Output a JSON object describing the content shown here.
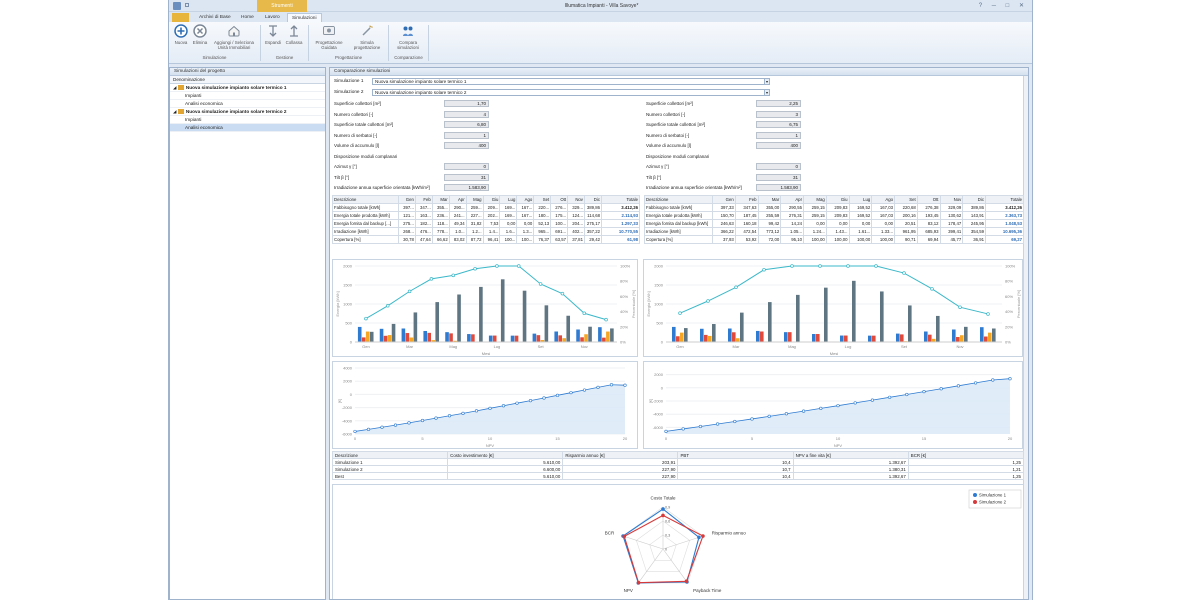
{
  "window": {
    "title": "Illumatica Impianti - Villa Savoye*",
    "context_tab": "Strumenti Simulazione",
    "controls": "? ─ □ ✕"
  },
  "tabs": [
    "",
    "Archivi di Base",
    "Home",
    "Lavoro",
    "Simulazioni"
  ],
  "ribbon": {
    "buttons": [
      {
        "label": "Nuova",
        "icon": "add-icon"
      },
      {
        "label": "Elimina",
        "icon": "delete-icon"
      },
      {
        "label": "Aggiungi / Seleziona Unità Immobiliari",
        "icon": "home-icon"
      },
      {
        "label": "Espandi",
        "icon": "expand-icon"
      },
      {
        "label": "Collassa",
        "icon": "collapse-icon"
      },
      {
        "label": "Progettazione Guidata",
        "icon": "wizard-icon"
      },
      {
        "label": "Simula progettazione",
        "icon": "magic-wand-icon"
      },
      {
        "label": "Compara simulazioni",
        "icon": "compare-icon"
      }
    ],
    "groups": [
      "Simulazione",
      "Gestione",
      "Progettazione",
      "Comparazione"
    ]
  },
  "left_panel": {
    "title": "Simulazioni del progetto",
    "column": "Denominazione",
    "tree": [
      {
        "label": "Nuova simulazione impianto solare termico 1",
        "level": 0,
        "bold": true
      },
      {
        "label": "Impianti",
        "level": 1
      },
      {
        "label": "Analisi economica",
        "level": 1
      },
      {
        "label": "Nuova simulazione impianto solare termico 2",
        "level": 0,
        "bold": true
      },
      {
        "label": "Impianti",
        "level": 1
      },
      {
        "label": "Analisi economica",
        "level": 1,
        "selected": true
      }
    ]
  },
  "main": {
    "title": "Comparazione simulazioni",
    "sim1_label": "Simulazione 1",
    "sim1_value": "Nuova simulazione impianto solare termico 1",
    "sim2_label": "Simulazione 2",
    "sim2_value": "Nuova simulazione impianto solare termico 2",
    "fields_labels": [
      "Superficie collettori [m²]",
      "Numero collettori [-]",
      "Superficie totale collettori [m²]",
      "Numero di serbatoi [-]",
      "Volume di accumulo [l]",
      "Disposizione moduli complanari",
      "Azimut γ [°]",
      "Tilt β [°]",
      "Irradiazione annua superficie orientata [kWh/m²]"
    ],
    "fields_left": [
      "1,70",
      "4",
      "6,80",
      "1",
      "400",
      "",
      "0",
      "31",
      "1.583,90"
    ],
    "fields_right": [
      "2,25",
      "3",
      "6,75",
      "1",
      "400",
      "",
      "0",
      "31",
      "1.583,90"
    ],
    "table_header": [
      "Descrizione",
      "Gen",
      "Feb",
      "Mar",
      "Apr",
      "Mag",
      "Giu",
      "Lug",
      "Ago",
      "Set",
      "Ott",
      "Nov",
      "Dic",
      "Totale"
    ],
    "table_left": [
      [
        "Fabbisogno totale [kWh]",
        "397...",
        "347...",
        "355...",
        "290...",
        "259...",
        "209...",
        "169...",
        "167...",
        "220...",
        "276...",
        "329...",
        "389,86",
        "3.412,26"
      ],
      [
        "Energia totale prodotta [kWh]",
        "121...",
        "163...",
        "236...",
        "241...",
        "227...",
        "202...",
        "169...",
        "167...",
        "180...",
        "175...",
        "124...",
        "114,68",
        "2.114,93"
      ],
      [
        "Energia fornita dal backup [...]",
        "275...",
        "182...",
        "118...",
        "49,34",
        "31,82",
        "7,53",
        "0,00",
        "0,00",
        "52,13",
        "100...",
        "204...",
        "275,17",
        "1.297,33"
      ],
      [
        "Irradiazione [kWh]",
        "268...",
        "476...",
        "778...",
        "1.0...",
        "1.2...",
        "1.4...",
        "1.6...",
        "1.3...",
        "965...",
        "691...",
        "402...",
        "357,22",
        "10.770,55"
      ],
      [
        "Copertura [%]",
        "30,78",
        "47,64",
        "66,62",
        "83,02",
        "87,72",
        "96,41",
        "100...",
        "100...",
        "76,37",
        "63,57",
        "37,81",
        "29,42",
        "61,98"
      ]
    ],
    "table_right": [
      [
        "Fabbisogno totale [kWh]",
        "397,33",
        "347,63",
        "355,00",
        "290,55",
        "259,15",
        "209,83",
        "169,52",
        "167,03",
        "220,68",
        "276,38",
        "329,09",
        "389,86",
        "3.412,26"
      ],
      [
        "Energia totale prodotta [kWh]",
        "150,70",
        "187,45",
        "255,59",
        "276,31",
        "259,15",
        "209,83",
        "169,52",
        "167,03",
        "200,16",
        "193,45",
        "130,62",
        "143,91",
        "2.363,73"
      ],
      [
        "Energia fornita dal backup [kWh]",
        "246,63",
        "160,18",
        "99,42",
        "14,24",
        "0,00",
        "0,00",
        "0,00",
        "0,00",
        "20,51",
        "83,12",
        "178,47",
        "245,95",
        "1.048,53"
      ],
      [
        "Irradiazione [kWh]",
        "366,22",
        "472,54",
        "773,12",
        "1.05...",
        "1.24...",
        "1.43...",
        "1.61...",
        "1.33...",
        "961,95",
        "685,93",
        "399,41",
        "354,59",
        "10.695,36"
      ],
      [
        "Copertura [%]",
        "37,93",
        "53,92",
        "72,00",
        "95,10",
        "100,00",
        "100,00",
        "100,00",
        "100,00",
        "90,71",
        "69,94",
        "45,77",
        "36,91",
        "69,27"
      ]
    ],
    "summary_header": [
      "Descrizione",
      "Costo investimento [€]",
      "Risparmio annuo [€]",
      "PBT",
      "NPV a fine vita [€]",
      "BCR [€]"
    ],
    "summary_rows": [
      [
        "Simulazione 1",
        "5.610,00",
        "203,91",
        "10,4",
        "1.392,67",
        "1,25"
      ],
      [
        "Simulazione 2",
        "6.600,00",
        "227,90",
        "10,7",
        "1.380,31",
        "1,21"
      ],
      [
        "Best",
        "5.610,00",
        "227,90",
        "10,4",
        "1.392,67",
        "1,25"
      ]
    ]
  },
  "chart_data": [
    {
      "type": "bar",
      "categories": [
        "Gen",
        "Feb",
        "Mar",
        "Apr",
        "Mag",
        "Giu",
        "Lug",
        "Ago",
        "Set",
        "Ott",
        "Nov",
        "Dic"
      ],
      "xlabel": "Mesi",
      "ylabel": "Energia [kWh]",
      "y2label": "Percentuale [%]",
      "tick_labels_x": [
        "Gen",
        "Mar",
        "Mag",
        "Lug",
        "Set",
        "Nov"
      ],
      "ylim": [
        0,
        2000
      ],
      "y2lim": [
        0,
        100
      ],
      "y_ticks": [
        "2000",
        "1500",
        "1000",
        "500",
        "0"
      ],
      "y2_ticks": [
        "100%",
        "80%",
        "60%",
        "40%",
        "20%",
        "0%"
      ],
      "series": [
        {
          "values": [
            397,
            347,
            355,
            290,
            259,
            209,
            169,
            167,
            220,
            276,
            329,
            390
          ],
          "color": "#2e7bd1"
        },
        {
          "values": [
            121,
            163,
            236,
            241,
            227,
            202,
            169,
            167,
            180,
            175,
            124,
            115
          ],
          "color": "#e04a3c"
        },
        {
          "values": [
            275,
            182,
            118,
            49,
            32,
            8,
            0,
            0,
            52,
            100,
            204,
            275
          ],
          "color": "#f5a623"
        },
        {
          "values": [
            268,
            476,
            778,
            1050,
            1250,
            1450,
            1650,
            1350,
            965,
            691,
            402,
            357
          ],
          "color": "#5f7582"
        },
        {
          "values": [
            30.78,
            47.64,
            66.62,
            83.02,
            87.72,
            96.41,
            100,
            100,
            76.37,
            63.57,
            37.81,
            29.42
          ],
          "color": "#3bb8c9",
          "axis": "y2",
          "kind": "line"
        }
      ]
    },
    {
      "type": "bar",
      "categories": [
        "Gen",
        "Feb",
        "Mar",
        "Apr",
        "Mag",
        "Giu",
        "Lug",
        "Ago",
        "Set",
        "Ott",
        "Nov",
        "Dic"
      ],
      "xlabel": "Mesi",
      "ylabel": "Energia [kWh]",
      "y2label": "Percentuale [%]",
      "tick_labels_x": [
        "Gen",
        "Mar",
        "Mag",
        "Lug",
        "Set",
        "Nov"
      ],
      "ylim": [
        0,
        2000
      ],
      "y2lim": [
        0,
        100
      ],
      "y_ticks": [
        "2000",
        "1500",
        "1000",
        "500",
        "0"
      ],
      "y2_ticks": [
        "100%",
        "80%",
        "60%",
        "40%",
        "20%",
        "0%"
      ],
      "series": [
        {
          "values": [
            397,
            348,
            355,
            291,
            259,
            210,
            170,
            167,
            221,
            276,
            329,
            390
          ],
          "color": "#2e7bd1"
        },
        {
          "values": [
            151,
            187,
            256,
            276,
            259,
            210,
            170,
            167,
            200,
            193,
            131,
            144
          ],
          "color": "#e04a3c"
        },
        {
          "values": [
            247,
            160,
            99,
            14,
            0,
            0,
            0,
            0,
            21,
            83,
            178,
            246
          ],
          "color": "#f5a623"
        },
        {
          "values": [
            366,
            473,
            773,
            1050,
            1240,
            1430,
            1610,
            1330,
            962,
            686,
            399,
            355
          ],
          "color": "#5f7582"
        },
        {
          "values": [
            37.93,
            53.92,
            72,
            95.1,
            100,
            100,
            100,
            100,
            90.71,
            69.94,
            45.77,
            36.91
          ],
          "color": "#3bb8c9",
          "axis": "y2",
          "kind": "line"
        }
      ]
    },
    {
      "type": "line",
      "xlabel": "NPV",
      "ylabel": "[€]",
      "x": [
        0,
        1,
        2,
        3,
        4,
        5,
        6,
        7,
        8,
        9,
        10,
        11,
        12,
        13,
        14,
        15,
        16,
        17,
        18,
        19,
        20
      ],
      "values": [
        -5610,
        -5300,
        -4980,
        -4650,
        -4310,
        -3960,
        -3600,
        -3240,
        -2870,
        -2490,
        -2110,
        -1720,
        -1330,
        -940,
        -540,
        -140,
        260,
        660,
        1060,
        1460,
        1393
      ],
      "xlim": [
        0,
        20
      ],
      "ylim": [
        -6000,
        4000
      ],
      "x_ticks": [
        "0",
        "5",
        "10",
        "15",
        "20"
      ],
      "y_ticks": [
        "4000",
        "2000",
        "0",
        "-2000",
        "-4000",
        "-6000"
      ]
    },
    {
      "type": "line",
      "xlabel": "NPV",
      "ylabel": "[€]",
      "x": [
        0,
        1,
        2,
        3,
        4,
        5,
        6,
        7,
        8,
        9,
        10,
        11,
        12,
        13,
        14,
        15,
        16,
        17,
        18,
        19,
        20
      ],
      "values": [
        -6600,
        -6230,
        -5860,
        -5490,
        -5110,
        -4720,
        -4330,
        -3930,
        -3530,
        -3120,
        -2710,
        -2290,
        -1870,
        -1440,
        -1010,
        -580,
        -140,
        300,
        740,
        1180,
        1380
      ],
      "xlim": [
        0,
        20
      ],
      "ylim": [
        -7000,
        3000
      ],
      "x_ticks": [
        "0",
        "5",
        "10",
        "15",
        "20"
      ],
      "y_ticks": [
        "2000",
        "0",
        "-2000",
        "-4000",
        "-6000"
      ]
    },
    {
      "type": "radar",
      "axes": [
        "Costo Totale",
        "Risparmio annuo",
        "Payback Time",
        "NPV",
        "BCR"
      ],
      "rings": [
        "0,9",
        "0,6",
        "0,3",
        "0"
      ],
      "legend": [
        "Simulazione 1",
        "Simulazione 2"
      ],
      "series": [
        {
          "name": "Simulazione 1",
          "values": [
            0.95,
            0.9,
            0.97,
            1.0,
            1.0
          ],
          "color": "#2e7bd1"
        },
        {
          "name": "Simulazione 2",
          "values": [
            0.8,
            1.0,
            0.95,
            0.99,
            0.97
          ],
          "color": "#d63a3a"
        }
      ]
    }
  ]
}
